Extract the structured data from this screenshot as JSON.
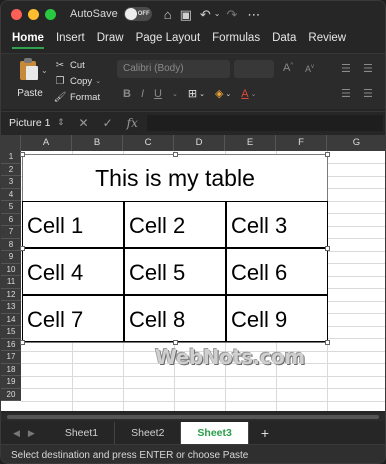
{
  "titlebar": {
    "autosave_label": "AutoSave",
    "toggle_state": "OFF"
  },
  "ribbon_tabs": [
    "Home",
    "Insert",
    "Draw",
    "Page Layout",
    "Formulas",
    "Data",
    "Review"
  ],
  "clipboard": {
    "paste_label": "Paste",
    "cut_label": "Cut",
    "copy_label": "Copy",
    "format_label": "Format"
  },
  "font": {
    "name": "Calibri (Body)"
  },
  "formula_bar": {
    "name_box": "Picture 1",
    "fx_label": "fx"
  },
  "columns": [
    "A",
    "B",
    "C",
    "D",
    "E",
    "F",
    "G"
  ],
  "rows": [
    "1",
    "2",
    "3",
    "4",
    "5",
    "6",
    "7",
    "8",
    "9",
    "10",
    "11",
    "12",
    "13",
    "14",
    "15",
    "16",
    "17",
    "18",
    "19",
    "20"
  ],
  "picture": {
    "title": "This is my table",
    "cells": [
      [
        "Cell 1",
        "Cell 2",
        "Cell 3"
      ],
      [
        "Cell 4",
        "Cell 5",
        "Cell 6"
      ],
      [
        "Cell 7",
        "Cell 8",
        "Cell 9"
      ]
    ]
  },
  "watermark": "WebNots.com",
  "sheets": [
    "Sheet1",
    "Sheet2",
    "Sheet3"
  ],
  "active_sheet": "Sheet3",
  "status_text": "Select destination and press ENTER or choose Paste",
  "colors": {
    "accent": "#2fa24f",
    "ribbon_bg": "#2b2b2b",
    "header_bg": "#3b3b3b"
  }
}
